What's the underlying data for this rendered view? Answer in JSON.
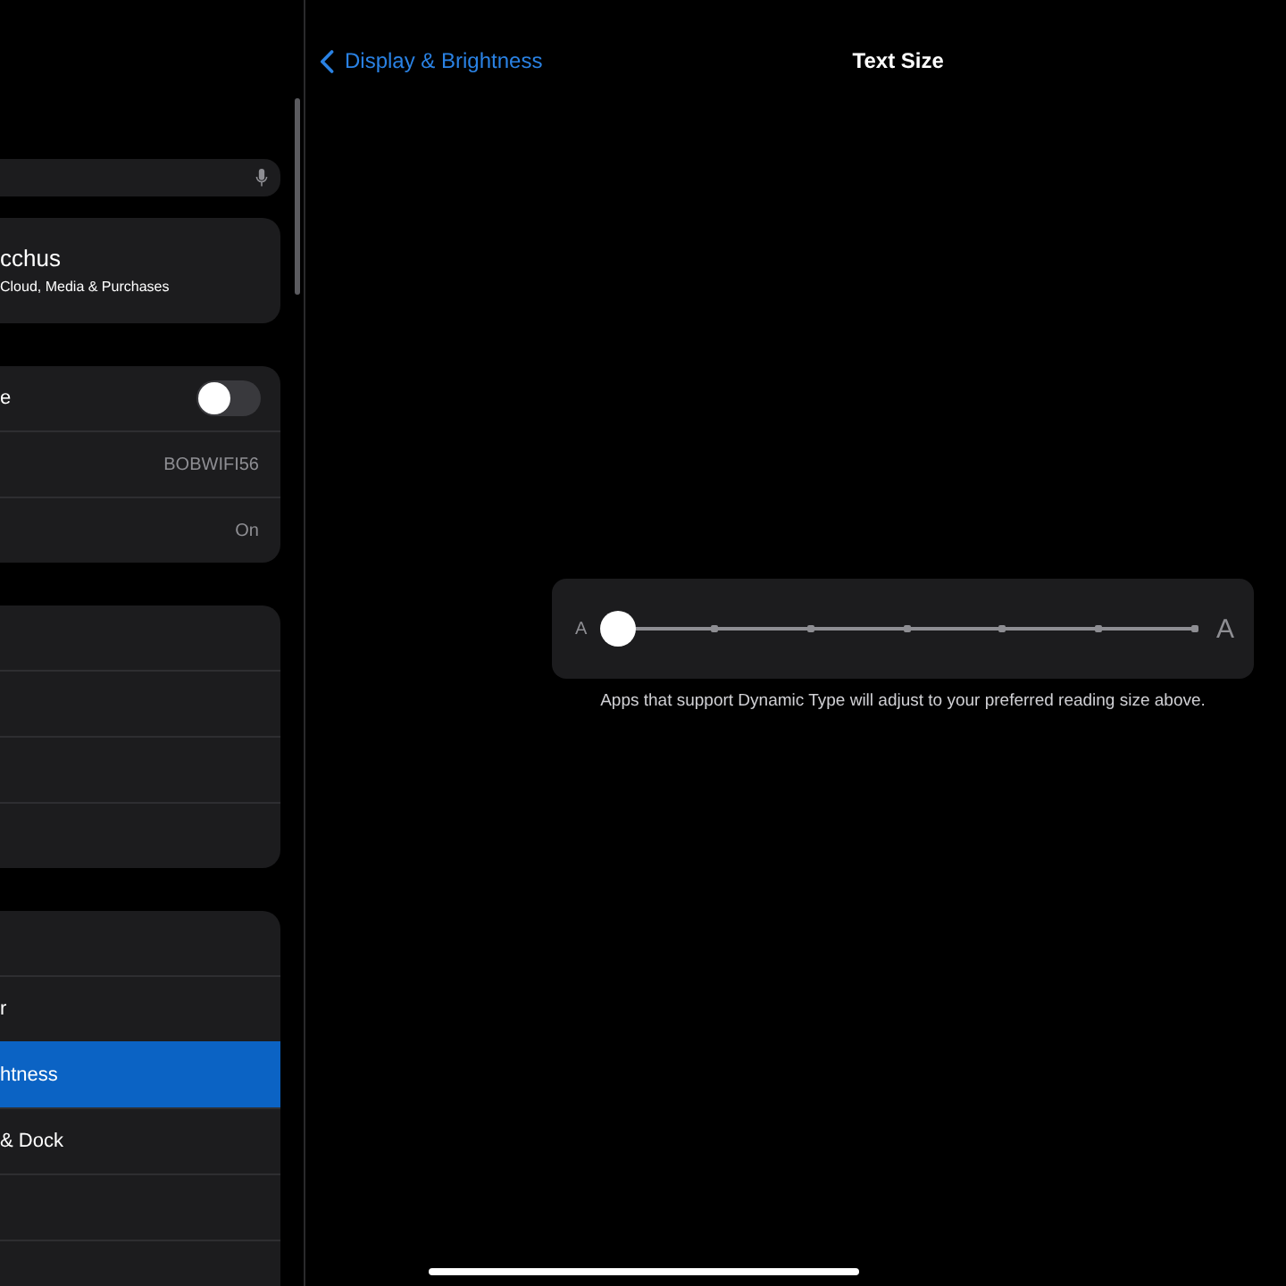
{
  "sidebar": {
    "account": {
      "name": "cchus",
      "subtitle": "Cloud, Media & Purchases"
    },
    "groups": [
      {
        "items": [
          {
            "kind": "toggle",
            "label": "e",
            "on": false,
            "selected": false
          },
          {
            "kind": "value",
            "value": "BOBWIFI56",
            "selected": false
          },
          {
            "kind": "value",
            "value": "On",
            "selected": false
          }
        ]
      },
      {
        "items": [
          {
            "kind": "link",
            "selected": false
          },
          {
            "kind": "link",
            "selected": false
          },
          {
            "kind": "link",
            "selected": false
          },
          {
            "kind": "link",
            "selected": false
          }
        ]
      },
      {
        "items": [
          {
            "kind": "link",
            "selected": false
          },
          {
            "kind": "link",
            "label": "r",
            "selected": false
          },
          {
            "kind": "link",
            "label": "htness",
            "selected": true
          },
          {
            "kind": "link",
            "label": "& Dock",
            "selected": false
          },
          {
            "kind": "link",
            "selected": false
          },
          {
            "kind": "link",
            "selected": false
          }
        ]
      }
    ]
  },
  "nav": {
    "back": "Display & Brightness",
    "title": "Text Size"
  },
  "text_size": {
    "small_label": "A",
    "large_label": "A",
    "level": 0,
    "caption": "Apps that support Dynamic Type will adjust to your preferred reading size above."
  }
}
